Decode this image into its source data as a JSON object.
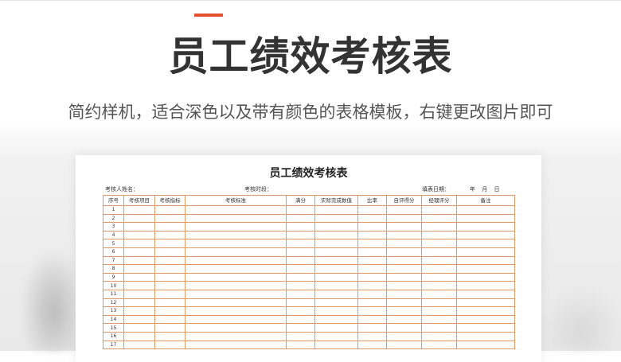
{
  "hero": {
    "title": "员工绩效考核表",
    "subtitle": "简约样机，适合深色以及带有颜色的表格模板，右键更改图片即可"
  },
  "sheet": {
    "title": "员工绩效考核表",
    "meta": {
      "assessee_label": "考核人姓名：",
      "period_label": "考核时段：",
      "date_label": "填表日期：",
      "date_units": "年 月 日"
    },
    "columns": [
      "序号",
      "考核项目",
      "考核指标",
      "考核标准",
      "满分",
      "实际完成数值",
      "比率",
      "自评得分",
      "经理评分",
      "备注"
    ],
    "row_numbers": [
      "1",
      "2",
      "3",
      "4",
      "5",
      "6",
      "7",
      "8",
      "9",
      "10",
      "11",
      "12",
      "13",
      "14",
      "15",
      "16",
      "17"
    ]
  },
  "colors": {
    "accent": "#e5502e",
    "grid_border": "#e09a66",
    "title_text": "#333333"
  }
}
